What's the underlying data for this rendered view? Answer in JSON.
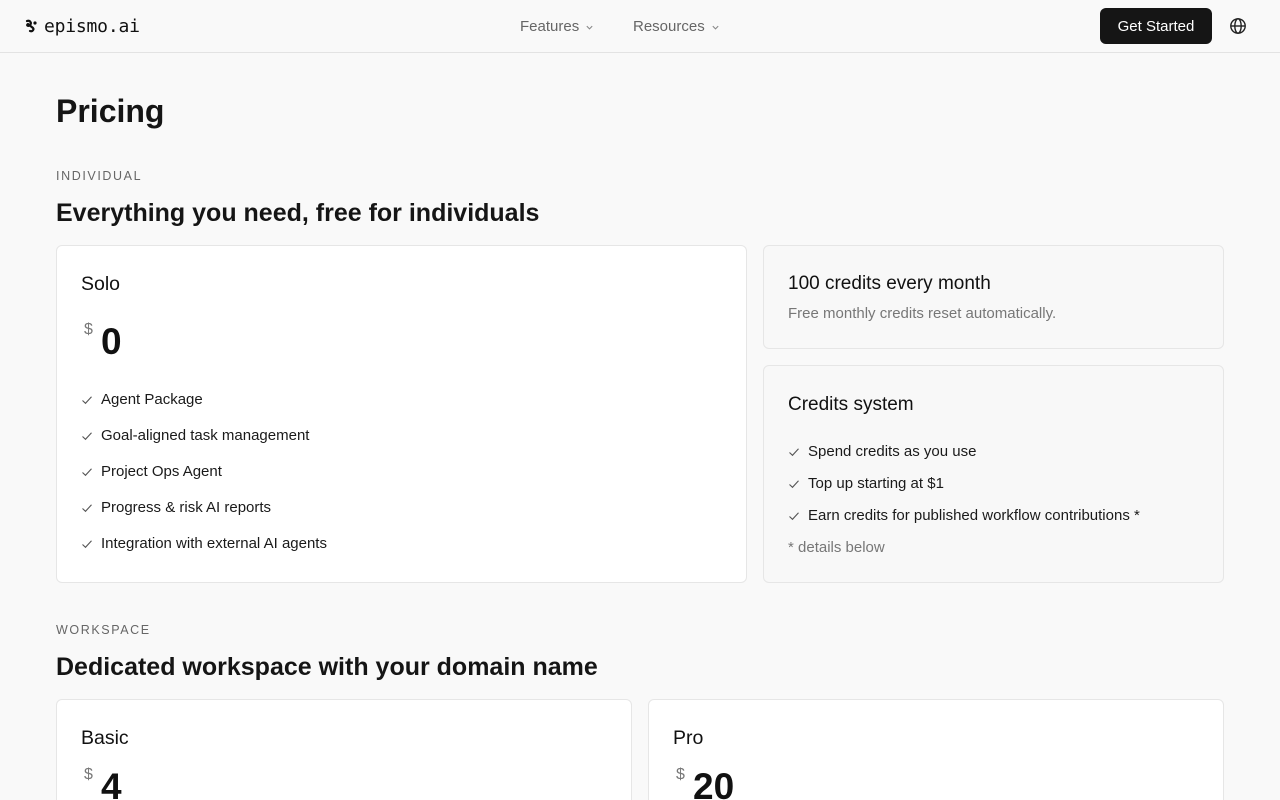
{
  "header": {
    "logo_text": "epismo.ai",
    "nav": [
      {
        "label": "Features"
      },
      {
        "label": "Resources"
      }
    ],
    "cta_label": "Get Started"
  },
  "page": {
    "title": "Pricing"
  },
  "individual": {
    "eyebrow": "INDIVIDUAL",
    "heading": "Everything you need, free for individuals",
    "plan": {
      "name": "Solo",
      "currency": "$",
      "price": "0",
      "features": [
        "Agent Package",
        "Goal-aligned task management",
        "Project Ops Agent",
        "Progress & risk AI reports",
        "Integration with external AI agents"
      ]
    },
    "credits_card": {
      "title": "100 credits every month",
      "subtitle": "Free monthly credits reset automatically."
    },
    "credits_system": {
      "title": "Credits system",
      "features": [
        "Spend credits as you use",
        "Top up starting at $1",
        "Earn credits for published workflow contributions *"
      ],
      "footnote": "* details below"
    }
  },
  "workspace": {
    "eyebrow": "WORKSPACE",
    "heading": "Dedicated workspace with your domain name",
    "plans": [
      {
        "name": "Basic",
        "currency": "$",
        "price": "4"
      },
      {
        "name": "Pro",
        "currency": "$",
        "price": "20"
      }
    ]
  },
  "colors": {
    "accent": "#151515",
    "background": "#f9f9f9",
    "card": "#ffffff",
    "muted_text": "#777777"
  }
}
